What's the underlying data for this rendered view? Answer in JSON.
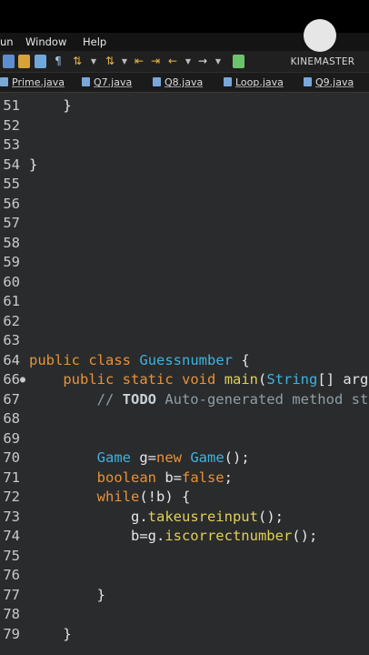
{
  "menu": {
    "items": [
      "un",
      "Window",
      "Help"
    ]
  },
  "tabs": [
    {
      "label": "Prime.java"
    },
    {
      "label": "Q7.java"
    },
    {
      "label": "Q8.java"
    },
    {
      "label": "Loop.java"
    },
    {
      "label": "Q9.java"
    }
  ],
  "watermark": {
    "text": "KINEMASTER"
  },
  "editor": {
    "lines": [
      {
        "num": "51",
        "tokens": [
          {
            "t": "    }",
            "c": "pl"
          }
        ]
      },
      {
        "num": "52",
        "tokens": []
      },
      {
        "num": "53",
        "tokens": []
      },
      {
        "num": "54",
        "tokens": [
          {
            "t": "}",
            "c": "pl"
          }
        ]
      },
      {
        "num": "55",
        "tokens": []
      },
      {
        "num": "56",
        "tokens": []
      },
      {
        "num": "57",
        "tokens": []
      },
      {
        "num": "58",
        "tokens": []
      },
      {
        "num": "59",
        "tokens": []
      },
      {
        "num": "60",
        "tokens": []
      },
      {
        "num": "61",
        "tokens": []
      },
      {
        "num": "62",
        "tokens": []
      },
      {
        "num": "63",
        "tokens": []
      },
      {
        "num": "64",
        "tokens": [
          {
            "t": "public",
            "c": "kw"
          },
          {
            "t": " ",
            "c": "pl"
          },
          {
            "t": "class",
            "c": "kw"
          },
          {
            "t": " ",
            "c": "pl"
          },
          {
            "t": "Guessnumber",
            "c": "ty"
          },
          {
            "t": " {",
            "c": "pl"
          }
        ]
      },
      {
        "num": "66",
        "marker": "●",
        "tokens": [
          {
            "t": "    ",
            "c": "pl"
          },
          {
            "t": "public",
            "c": "kw"
          },
          {
            "t": " ",
            "c": "pl"
          },
          {
            "t": "static",
            "c": "kw"
          },
          {
            "t": " ",
            "c": "pl"
          },
          {
            "t": "void",
            "c": "kw"
          },
          {
            "t": " ",
            "c": "pl"
          },
          {
            "t": "main",
            "c": "mt"
          },
          {
            "t": "(",
            "c": "pl"
          },
          {
            "t": "String",
            "c": "ty"
          },
          {
            "t": "[] args) {",
            "c": "pl"
          }
        ]
      },
      {
        "num": "67",
        "tokens": [
          {
            "t": "        // ",
            "c": "cm"
          },
          {
            "t": "TODO",
            "c": "td"
          },
          {
            "t": " Auto-generated method stub",
            "c": "cm"
          }
        ]
      },
      {
        "num": "68",
        "tokens": []
      },
      {
        "num": "69",
        "tokens": []
      },
      {
        "num": "70",
        "tokens": [
          {
            "t": "        ",
            "c": "pl"
          },
          {
            "t": "Game",
            "c": "ty"
          },
          {
            "t": " g=",
            "c": "pl"
          },
          {
            "t": "new",
            "c": "kw"
          },
          {
            "t": " ",
            "c": "pl"
          },
          {
            "t": "Game",
            "c": "ty"
          },
          {
            "t": "();",
            "c": "pl"
          }
        ]
      },
      {
        "num": "71",
        "tokens": [
          {
            "t": "        ",
            "c": "pl"
          },
          {
            "t": "boolean",
            "c": "kw"
          },
          {
            "t": " b=",
            "c": "pl"
          },
          {
            "t": "false",
            "c": "kw"
          },
          {
            "t": ";",
            "c": "pl"
          }
        ]
      },
      {
        "num": "72",
        "tokens": [
          {
            "t": "        ",
            "c": "pl"
          },
          {
            "t": "while",
            "c": "kw"
          },
          {
            "t": "(!b) {",
            "c": "pl"
          }
        ]
      },
      {
        "num": "73",
        "tokens": [
          {
            "t": "            g.",
            "c": "pl"
          },
          {
            "t": "takeusreinput",
            "c": "mt"
          },
          {
            "t": "();",
            "c": "pl"
          }
        ]
      },
      {
        "num": "74",
        "tokens": [
          {
            "t": "            b=g.",
            "c": "pl"
          },
          {
            "t": "iscorrectnumber",
            "c": "mt"
          },
          {
            "t": "();",
            "c": "pl"
          }
        ]
      },
      {
        "num": "75",
        "tokens": []
      },
      {
        "num": "76",
        "tokens": []
      },
      {
        "num": "77",
        "tokens": [
          {
            "t": "        }",
            "c": "pl"
          }
        ]
      },
      {
        "num": "78",
        "tokens": []
      },
      {
        "num": "79",
        "tokens": [
          {
            "t": "    }",
            "c": "pl"
          }
        ]
      }
    ]
  }
}
